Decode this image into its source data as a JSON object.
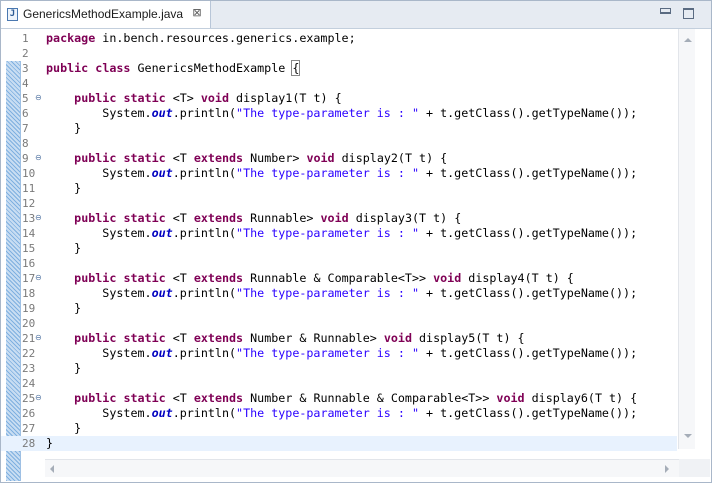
{
  "tab": {
    "title": "GenericsMethodExample.java",
    "icon": "java-file-icon",
    "icon_letter": "J",
    "close": "⊠"
  },
  "window_controls": [
    "minimize-icon",
    "maximize-icon"
  ],
  "lines": [
    [
      [
        "kw",
        "package"
      ],
      [
        "t",
        " in.bench.resources.generics.example;"
      ]
    ],
    [],
    [
      [
        "kw",
        "public"
      ],
      [
        "t",
        " "
      ],
      [
        "kw",
        "class"
      ],
      [
        "t",
        " GenericsMethodExample "
      ],
      [
        "hl",
        "{"
      ]
    ],
    [],
    [
      [
        "t",
        "    "
      ],
      [
        "kw",
        "public"
      ],
      [
        "t",
        " "
      ],
      [
        "kw",
        "static"
      ],
      [
        "t",
        " <T> "
      ],
      [
        "kw",
        "void"
      ],
      [
        "t",
        " display1(T t) {"
      ]
    ],
    [
      [
        "t",
        "        System."
      ],
      [
        "fld",
        "out"
      ],
      [
        "t",
        ".println("
      ],
      [
        "str",
        "\"The type-parameter is : \""
      ],
      [
        "t",
        " + t.getClass().getTypeName());"
      ]
    ],
    [
      [
        "t",
        "    }"
      ]
    ],
    [],
    [
      [
        "t",
        "    "
      ],
      [
        "kw",
        "public"
      ],
      [
        "t",
        " "
      ],
      [
        "kw",
        "static"
      ],
      [
        "t",
        " <T "
      ],
      [
        "kw",
        "extends"
      ],
      [
        "t",
        " Number> "
      ],
      [
        "kw",
        "void"
      ],
      [
        "t",
        " display2(T t) {"
      ]
    ],
    [
      [
        "t",
        "        System."
      ],
      [
        "fld",
        "out"
      ],
      [
        "t",
        ".println("
      ],
      [
        "str",
        "\"The type-parameter is : \""
      ],
      [
        "t",
        " + t.getClass().getTypeName());"
      ]
    ],
    [
      [
        "t",
        "    }"
      ]
    ],
    [],
    [
      [
        "t",
        "    "
      ],
      [
        "kw",
        "public"
      ],
      [
        "t",
        " "
      ],
      [
        "kw",
        "static"
      ],
      [
        "t",
        " <T "
      ],
      [
        "kw",
        "extends"
      ],
      [
        "t",
        " Runnable> "
      ],
      [
        "kw",
        "void"
      ],
      [
        "t",
        " display3(T t) {"
      ]
    ],
    [
      [
        "t",
        "        System."
      ],
      [
        "fld",
        "out"
      ],
      [
        "t",
        ".println("
      ],
      [
        "str",
        "\"The type-parameter is : \""
      ],
      [
        "t",
        " + t.getClass().getTypeName());"
      ]
    ],
    [
      [
        "t",
        "    }"
      ]
    ],
    [],
    [
      [
        "t",
        "    "
      ],
      [
        "kw",
        "public"
      ],
      [
        "t",
        " "
      ],
      [
        "kw",
        "static"
      ],
      [
        "t",
        " <T "
      ],
      [
        "kw",
        "extends"
      ],
      [
        "t",
        " Runnable & Comparable<T>> "
      ],
      [
        "kw",
        "void"
      ],
      [
        "t",
        " display4(T t) {"
      ]
    ],
    [
      [
        "t",
        "        System."
      ],
      [
        "fld",
        "out"
      ],
      [
        "t",
        ".println("
      ],
      [
        "str",
        "\"The type-parameter is : \""
      ],
      [
        "t",
        " + t.getClass().getTypeName());"
      ]
    ],
    [
      [
        "t",
        "    }"
      ]
    ],
    [],
    [
      [
        "t",
        "    "
      ],
      [
        "kw",
        "public"
      ],
      [
        "t",
        " "
      ],
      [
        "kw",
        "static"
      ],
      [
        "t",
        " <T "
      ],
      [
        "kw",
        "extends"
      ],
      [
        "t",
        " Number & Runnable> "
      ],
      [
        "kw",
        "void"
      ],
      [
        "t",
        " display5(T t) {"
      ]
    ],
    [
      [
        "t",
        "        System."
      ],
      [
        "fld",
        "out"
      ],
      [
        "t",
        ".println("
      ],
      [
        "str",
        "\"The type-parameter is : \""
      ],
      [
        "t",
        " + t.getClass().getTypeName());"
      ]
    ],
    [
      [
        "t",
        "    }"
      ]
    ],
    [],
    [
      [
        "t",
        "    "
      ],
      [
        "kw",
        "public"
      ],
      [
        "t",
        " "
      ],
      [
        "kw",
        "static"
      ],
      [
        "t",
        " <T "
      ],
      [
        "kw",
        "extends"
      ],
      [
        "t",
        " Number & Runnable & Comparable<T>> "
      ],
      [
        "kw",
        "void"
      ],
      [
        "t",
        " display6(T t) {"
      ]
    ],
    [
      [
        "t",
        "        System."
      ],
      [
        "fld",
        "out"
      ],
      [
        "t",
        ".println("
      ],
      [
        "str",
        "\"The type-parameter is : \""
      ],
      [
        "t",
        " + t.getClass().getTypeName());"
      ]
    ],
    [
      [
        "t",
        "    }"
      ]
    ],
    [
      [
        "t",
        "}"
      ]
    ]
  ],
  "fold_lines": [
    5,
    9,
    13,
    17,
    21,
    25
  ],
  "fold_symbol": "⊖",
  "current_line": 28,
  "colors": {
    "keyword": "#7f0055",
    "string": "#2a00ff",
    "field": "#0000c0",
    "line_number": "#7a7a7a",
    "current_line_bg": "#e8f2fe"
  }
}
